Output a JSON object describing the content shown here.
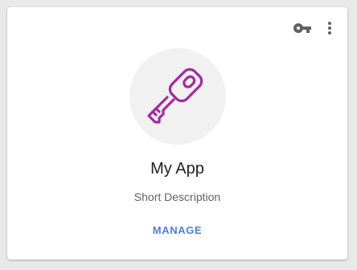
{
  "card": {
    "title": "My App",
    "description": "Short Description",
    "manage_label": "MANAGE",
    "avatar_icon": "key-icon",
    "accent_color": "#a52aa2",
    "link_color": "#4a7fe0"
  },
  "actions": {
    "key_icon": "key-icon",
    "more_icon": "more-vert-icon"
  }
}
